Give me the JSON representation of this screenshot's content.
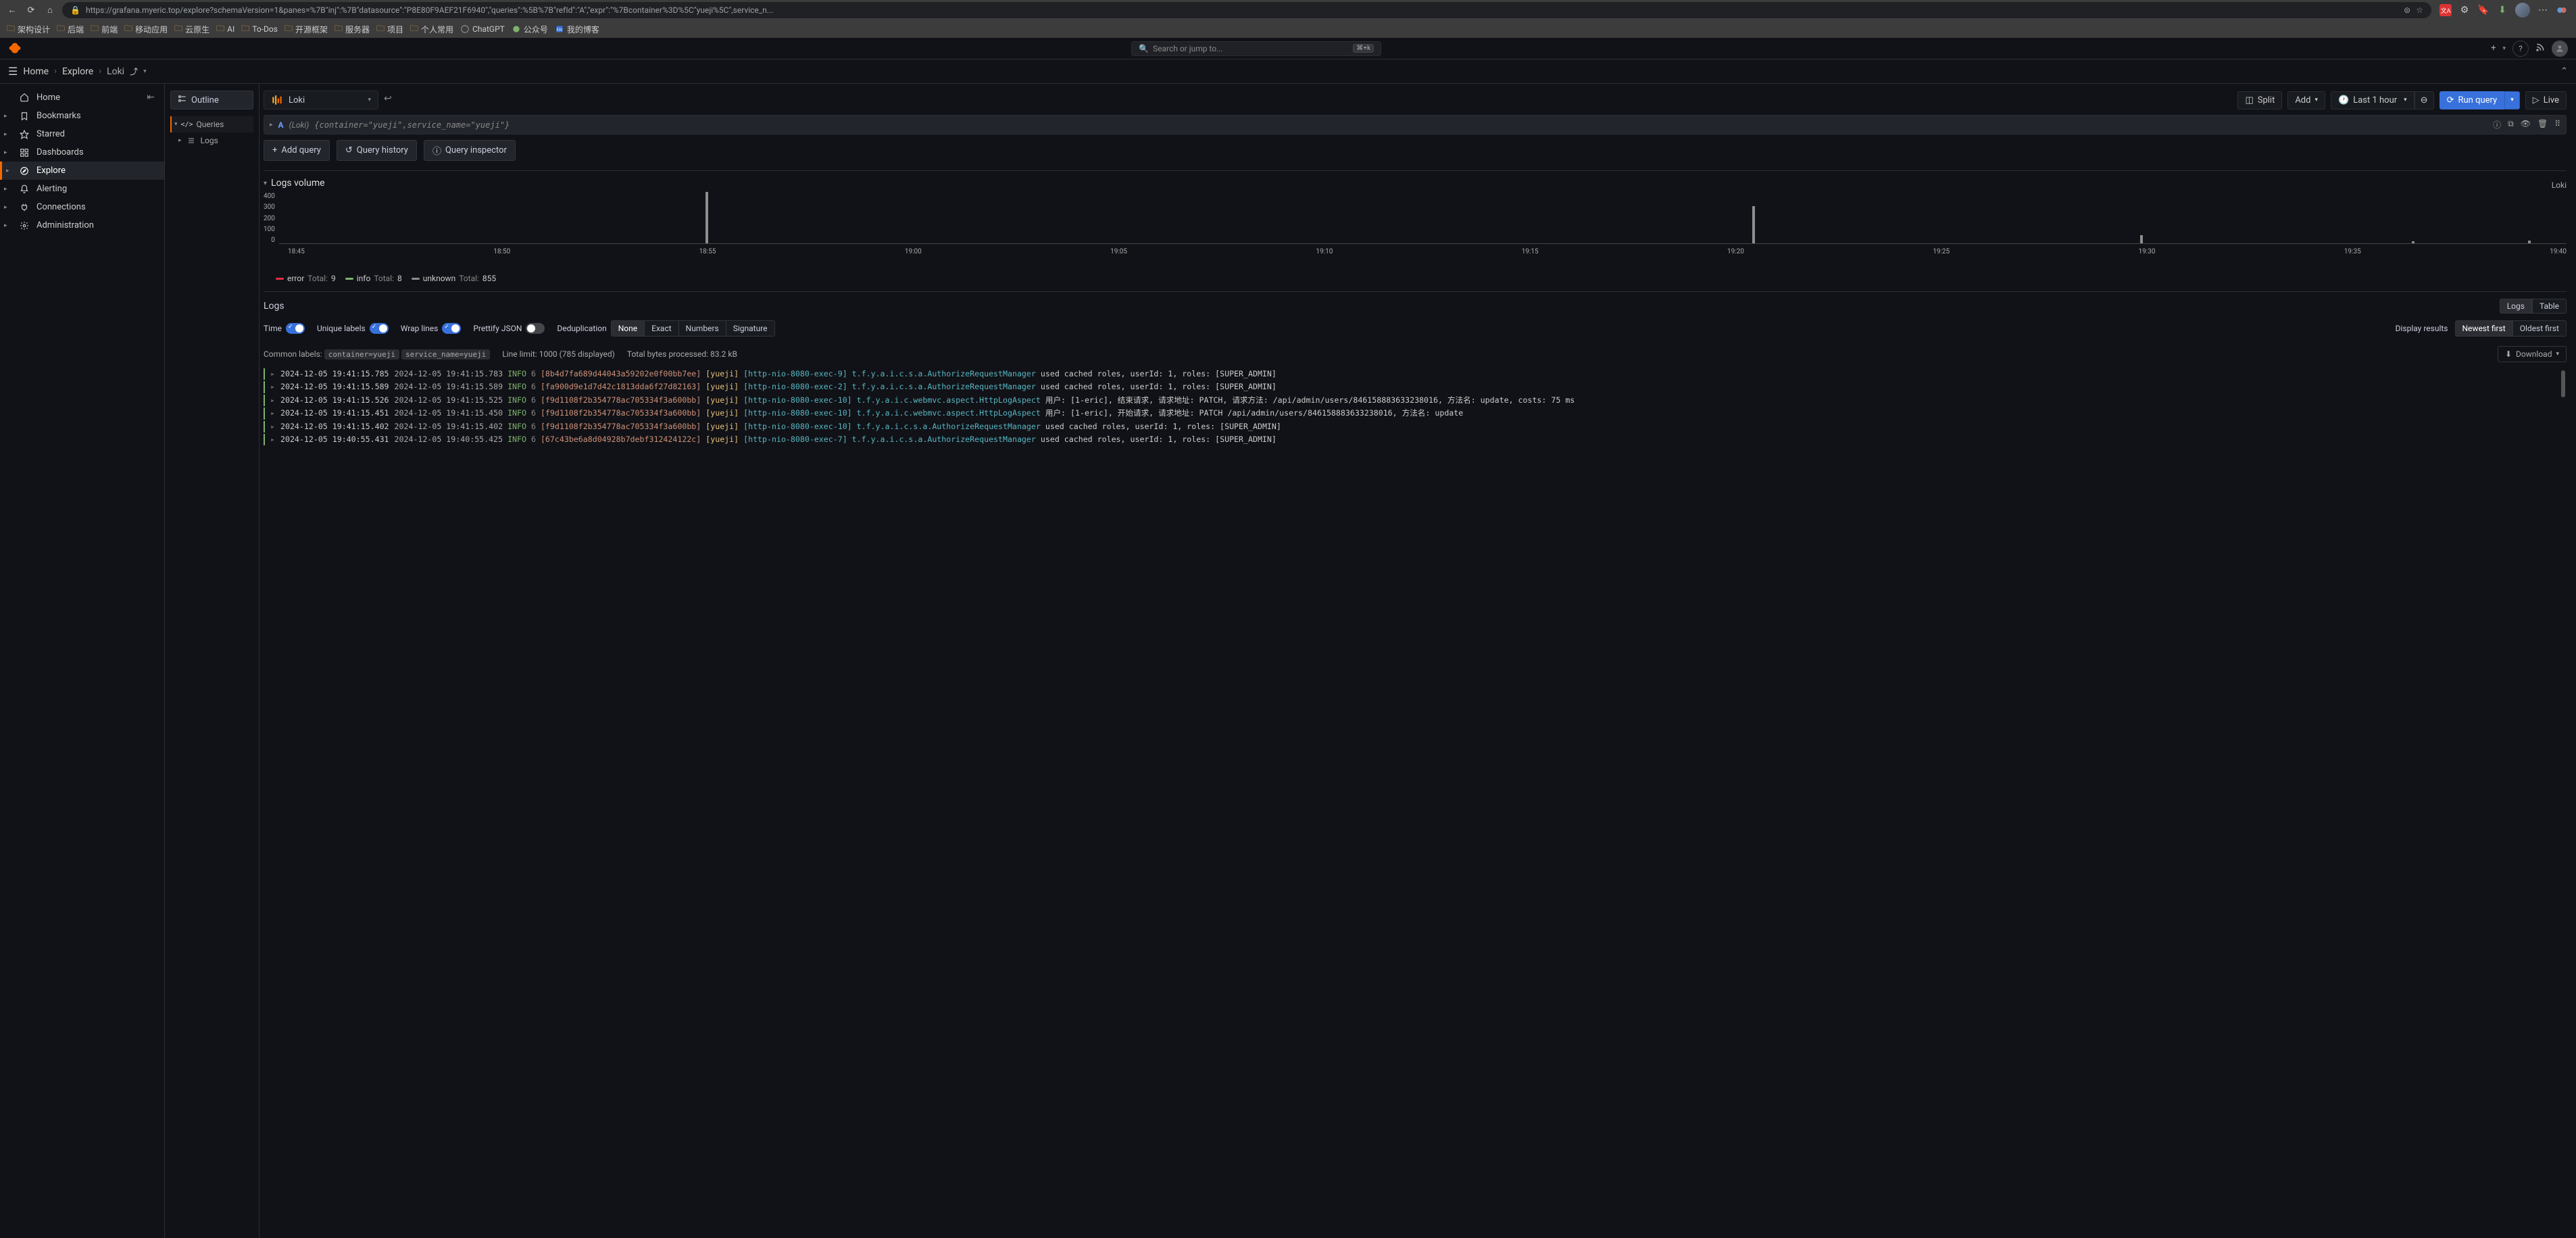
{
  "browser": {
    "url": "https://grafana.myeric.top/explore?schemaVersion=1&panes=%7B\"inj\":%7B\"datasource\":\"P8E80F9AEF21F6940\",\"queries\":%5B%7B\"refId\":\"A\",\"expr\":\"%7Bcontainer%3D%5C\"yueji%5C\",service_n...",
    "bookmarks": [
      {
        "icon": "folder",
        "label": "架构设计"
      },
      {
        "icon": "folder",
        "label": "后端"
      },
      {
        "icon": "folder",
        "label": "前端"
      },
      {
        "icon": "folder",
        "label": "移动应用"
      },
      {
        "icon": "folder",
        "label": "云原生"
      },
      {
        "icon": "folder",
        "label": "AI"
      },
      {
        "icon": "folder",
        "label": "To-Dos"
      },
      {
        "icon": "folder",
        "label": "开源框架"
      },
      {
        "icon": "folder",
        "label": "服务器"
      },
      {
        "icon": "folder",
        "label": "项目"
      },
      {
        "icon": "folder",
        "label": "个人常用"
      },
      {
        "icon": "chatgpt",
        "label": "ChatGPT"
      },
      {
        "icon": "wechat",
        "label": "公众号"
      },
      {
        "icon": "blog",
        "label": "我的博客"
      }
    ]
  },
  "header": {
    "search_placeholder": "Search or jump to...",
    "shortcut": "⌘+k"
  },
  "breadcrumb": [
    "Home",
    "Explore",
    "Loki"
  ],
  "sidebar": {
    "items": [
      {
        "label": "Home",
        "icon": "home",
        "expandable": false
      },
      {
        "label": "Bookmarks",
        "icon": "bookmark",
        "expandable": true
      },
      {
        "label": "Starred",
        "icon": "star",
        "expandable": true
      },
      {
        "label": "Dashboards",
        "icon": "grid",
        "expandable": true
      },
      {
        "label": "Explore",
        "icon": "compass",
        "expandable": true,
        "active": true
      },
      {
        "label": "Alerting",
        "icon": "bell",
        "expandable": true
      },
      {
        "label": "Connections",
        "icon": "plug",
        "expandable": true
      },
      {
        "label": "Administration",
        "icon": "gear",
        "expandable": true
      }
    ]
  },
  "outline": {
    "title": "Outline",
    "tree": [
      {
        "label": "Queries",
        "icon": "code",
        "active": true
      },
      {
        "label": "Logs",
        "icon": "list"
      }
    ]
  },
  "toolbar": {
    "datasource": "Loki",
    "split": "Split",
    "add": "Add",
    "time_range": "Last 1 hour",
    "run_query": "Run query",
    "live": "Live"
  },
  "query": {
    "ref": "A",
    "ds": "(Loki)",
    "expr": "{container=\"yueji\",service_name=\"yueji\"}"
  },
  "secondary_toolbar": {
    "add_query": "Add query",
    "history": "Query history",
    "inspector": "Query inspector"
  },
  "logs_volume": {
    "title": "Logs volume",
    "ds_label": "Loki",
    "legend": [
      {
        "name": "error",
        "total_label": "Total:",
        "total": 9,
        "color": "#e02f44"
      },
      {
        "name": "info",
        "total_label": "Total:",
        "total": 8,
        "color": "#7eb26d"
      },
      {
        "name": "unknown",
        "total_label": "Total:",
        "total": 855,
        "color": "#8e8e8e"
      }
    ]
  },
  "chart_data": {
    "type": "bar",
    "title": "Logs volume",
    "xlabel": "",
    "ylabel": "",
    "ylim": [
      0,
      400
    ],
    "x_ticks": [
      "18:45",
      "18:50",
      "18:55",
      "19:00",
      "19:05",
      "19:10",
      "19:15",
      "19:20",
      "19:25",
      "19:30",
      "19:35",
      "19:40"
    ],
    "y_ticks": [
      0,
      100,
      200,
      300,
      400
    ],
    "series": [
      {
        "name": "unknown",
        "color": "#8e8e8e",
        "points": [
          {
            "x": "18:54",
            "value": 400
          },
          {
            "x": "19:21",
            "value": 290
          },
          {
            "x": "19:31",
            "value": 65
          },
          {
            "x": "19:38",
            "value": 18
          },
          {
            "x": "19:41",
            "value": 22
          }
        ]
      }
    ]
  },
  "logs_panel": {
    "title": "Logs",
    "view_toggles": [
      "Logs",
      "Table"
    ],
    "active_view": "Logs",
    "options": {
      "time": "Time",
      "unique_labels": "Unique labels",
      "wrap_lines": "Wrap lines",
      "prettify_json": "Prettify JSON",
      "dedup": "Deduplication",
      "dedup_options": [
        "None",
        "Exact",
        "Numbers",
        "Signature"
      ],
      "dedup_active": "None",
      "display_results": "Display results",
      "sort_options": [
        "Newest first",
        "Oldest first"
      ],
      "sort_active": "Newest first"
    },
    "meta": {
      "common_labels_label": "Common labels:",
      "common_labels": [
        "container=yueji",
        "service_name=yueji"
      ],
      "line_limit_label": "Line limit:",
      "line_limit": "1000 (785 displayed)",
      "bytes_label": "Total bytes processed:",
      "bytes": "83.2 kB",
      "download": "Download"
    },
    "rows": [
      {
        "ts": "2024-12-05 19:41:15.785",
        "ts2": "2024-12-05 19:41:15.783",
        "level": "INFO",
        "n": "6",
        "trace": "[8b4d7fa689d44043a59202e0f00bb7ee]",
        "svc": "[yueji]",
        "thread": "[http-nio-8080-exec-9]",
        "cls": "t.f.y.a.i.c.s.a.AuthorizeRequestManager",
        "msg": "used cached roles, userId: 1, roles: [SUPER_ADMIN]"
      },
      {
        "ts": "2024-12-05 19:41:15.589",
        "ts2": "2024-12-05 19:41:15.589",
        "level": "INFO",
        "n": "6",
        "trace": "[fa900d9e1d7d42c1813dda6f27d82163]",
        "svc": "[yueji]",
        "thread": "[http-nio-8080-exec-2]",
        "cls": "t.f.y.a.i.c.s.a.AuthorizeRequestManager",
        "msg": "used cached roles, userId: 1, roles: [SUPER_ADMIN]"
      },
      {
        "ts": "2024-12-05 19:41:15.526",
        "ts2": "2024-12-05 19:41:15.525",
        "level": "INFO",
        "n": "6",
        "trace": "[f9d1108f2b354778ac705334f3a600bb]",
        "svc": "[yueji]",
        "thread": "[http-nio-8080-exec-10]",
        "cls": "t.f.y.a.i.c.webmvc.aspect.HttpLogAspect",
        "msg": "用户: [1-eric], 结束请求, 请求地址: PATCH, 请求方法: /api/admin/users/846158883633238016, 方法名: update, costs: 75 ms"
      },
      {
        "ts": "2024-12-05 19:41:15.451",
        "ts2": "2024-12-05 19:41:15.450",
        "level": "INFO",
        "n": "6",
        "trace": "[f9d1108f2b354778ac705334f3a600bb]",
        "svc": "[yueji]",
        "thread": "[http-nio-8080-exec-10]",
        "cls": "t.f.y.a.i.c.webmvc.aspect.HttpLogAspect",
        "msg": "用户: [1-eric], 开始请求, 请求地址: PATCH /api/admin/users/846158883633238016, 方法名: update"
      },
      {
        "ts": "2024-12-05 19:41:15.402",
        "ts2": "2024-12-05 19:41:15.402",
        "level": "INFO",
        "n": "6",
        "trace": "[f9d1108f2b354778ac705334f3a600bb]",
        "svc": "[yueji]",
        "thread": "[http-nio-8080-exec-10]",
        "cls": "t.f.y.a.i.c.s.a.AuthorizeRequestManager",
        "msg": "used cached roles, userId: 1, roles: [SUPER_ADMIN]"
      },
      {
        "ts": "2024-12-05 19:40:55.431",
        "ts2": "2024-12-05 19:40:55.425",
        "level": "INFO",
        "n": "6",
        "trace": "[67c43be6a8d04928b7debf312424122c]",
        "svc": "[yueji]",
        "thread": "[http-nio-8080-exec-7]",
        "cls": "t.f.y.a.i.c.s.a.AuthorizeRequestManager",
        "msg": "used cached roles, userId: 1, roles: [SUPER_ADMIN]"
      }
    ]
  }
}
